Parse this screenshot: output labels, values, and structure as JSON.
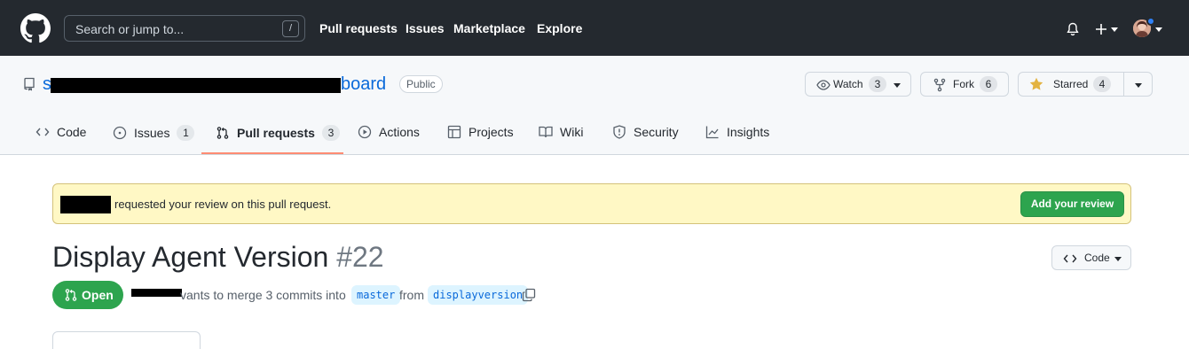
{
  "header": {
    "search_placeholder": "Search or jump to...",
    "search_shortcut": "/",
    "nav": [
      "Pull requests",
      "Issues",
      "Marketplace",
      "Explore"
    ],
    "plus_label": "+",
    "bg_color": "#24292f"
  },
  "repo": {
    "name_visible_tail": "board",
    "name_visible_head": "s",
    "visibility": "Public",
    "watch_label": "Watch",
    "watch_count": "3",
    "fork_label": "Fork",
    "fork_count": "6",
    "star_label": "Starred",
    "star_count": "4"
  },
  "tabs": [
    {
      "label": "Code",
      "count": null,
      "icon": "code-icon"
    },
    {
      "label": "Issues",
      "count": "1",
      "icon": "issue-opened-icon"
    },
    {
      "label": "Pull requests",
      "count": "3",
      "icon": "git-pull-request-icon",
      "selected": true
    },
    {
      "label": "Actions",
      "count": null,
      "icon": "play-icon"
    },
    {
      "label": "Projects",
      "count": null,
      "icon": "table-icon"
    },
    {
      "label": "Wiki",
      "count": null,
      "icon": "book-icon"
    },
    {
      "label": "Security",
      "count": null,
      "icon": "shield-icon"
    },
    {
      "label": "Insights",
      "count": null,
      "icon": "graph-icon"
    }
  ],
  "banner": {
    "message": "requested your review on this pull request.",
    "button": "Add your review",
    "bg_color": "#fff8c5"
  },
  "pr": {
    "title": "Display Agent Version",
    "number": "#22",
    "code_button": "Code",
    "state": "Open",
    "merge_text_visible": "vants to merge 3 commits into",
    "base_branch": "master",
    "from_text": "from",
    "head_branch": "displayversion",
    "accent_green": "#2da44e"
  }
}
